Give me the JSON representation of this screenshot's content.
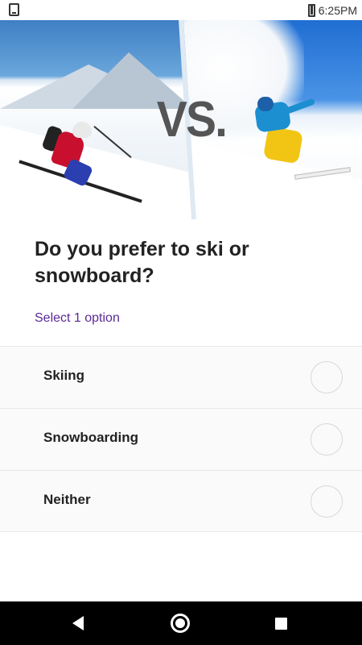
{
  "status_bar": {
    "time": "6:25PM",
    "left_icon": "download-icon",
    "battery_icon": "battery-charging-icon"
  },
  "hero": {
    "overlay_text": "VS.",
    "left_image": "skier-photo",
    "right_image": "snowboarder-photo"
  },
  "question": {
    "title": "Do you prefer to ski or snowboard?",
    "hint": "Select 1 option"
  },
  "options": [
    {
      "label": "Skiing",
      "selected": false
    },
    {
      "label": "Snowboarding",
      "selected": false
    },
    {
      "label": "Neither",
      "selected": false
    }
  ],
  "colors": {
    "hint": "#5b2a98",
    "text": "#222222",
    "option_bg": "#fafafa",
    "nav_bg": "#000000"
  },
  "nav_bar": {
    "back_icon": "back-triangle-icon",
    "home_icon": "home-circle-icon",
    "recents_icon": "recents-square-icon"
  }
}
